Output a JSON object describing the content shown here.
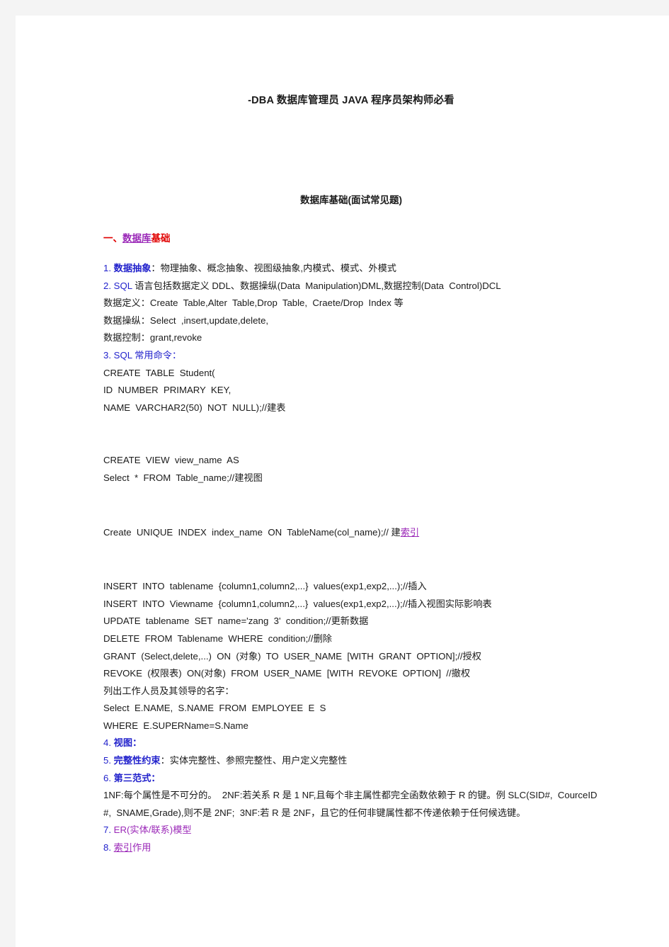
{
  "document": {
    "title": "-DBA 数据库管理员 JAVA 程序员架构师必看",
    "subtitle": "数据库基础(面试常见题)",
    "section_heading": {
      "prefix": "一、",
      "link": "数据库",
      "suffix": "基础"
    },
    "items": [
      {
        "number": "1.",
        "keyword": "数据抽象",
        "rest": "：物理抽象、概念抽象、视图级抽象,内模式、模式、外模式"
      },
      {
        "number": "2.",
        "keyword": "SQL",
        "rest": "语言包括数据定义 DDL、数据操纵(Data  Manipulation)DML,数据控制(Data  Control)DCL"
      }
    ],
    "sql_sublines": [
      "数据定义：Create  Table,Alter  Table,Drop  Table,  Craete/Drop  Index 等",
      "数据操纵：Select  ,insert,update,delete,",
      "数据控制：grant,revoke"
    ],
    "item3": {
      "number": "3.",
      "keyword": "SQL 常用命令",
      "rest": "："
    },
    "create_table_block": [
      "CREATE  TABLE  Student(",
      "ID  NUMBER  PRIMARY  KEY,",
      "NAME  VARCHAR2(50)  NOT  NULL);//建表"
    ],
    "create_view_block": [
      "CREATE  VIEW  view_name  AS",
      "Select  *  FROM  Table_name;//建视图"
    ],
    "create_index_line": {
      "prefix": "Create  UNIQUE  INDEX  index_name  ON  TableName(col_name);// 建",
      "link": "索引"
    },
    "dml_block": [
      "INSERT  INTO  tablename  {column1,column2,...}  values(exp1,exp2,...);//插入",
      "INSERT  INTO  Viewname  {column1,column2,...}  values(exp1,exp2,...);//插入视图实际影响表",
      "UPDATE  tablename  SET  name='zang  3'  condition;//更新数据",
      "DELETE  FROM  Tablename  WHERE  condition;//删除",
      "GRANT  (Select,delete,...)  ON  (对象)  TO  USER_NAME  [WITH  GRANT  OPTION];//授权",
      "REVOKE  (权限表)  ON(对象)  FROM  USER_NAME  [WITH  REVOKE  OPTION]  //撤权",
      "列出工作人员及其领导的名字：",
      "Select  E.NAME,  S.NAME  FROM  EMPLOYEE  E  S",
      "WHERE  E.SUPERName=S.Name"
    ],
    "item4": {
      "number": "4.",
      "keyword": "视图",
      "rest": "："
    },
    "item5": {
      "number": "5.",
      "keyword": "完整性约束",
      "rest": "：实体完整性、参照完整性、用户定义完整性"
    },
    "item6": {
      "number": "6.",
      "keyword": "第三范式",
      "rest": "："
    },
    "nf_paragraph": "1NF:每个属性是不可分的。  2NF:若关系 R 是 1 NF,且每个非主属性都完全函数依赖于 R 的键。例 SLC(SID#,  CourceID#,  SNAME,Grade),则不是 2NF;  3NF:若 R 是 2NF，且它的任何非键属性都不传递依赖于任何候选键。",
    "item7": {
      "number": "7.",
      "text": "ER(实体/联系)模型"
    },
    "item8": {
      "number": "8.",
      "link": "索引",
      "rest": "作用"
    }
  },
  "colors": {
    "page_background": "#ffffff",
    "canvas_background": "#f4f4f4",
    "body_text": "#1a1a1a",
    "heading_red": "#e00000",
    "link_purple": "#9b29b8",
    "item_blue": "#2222cc"
  }
}
